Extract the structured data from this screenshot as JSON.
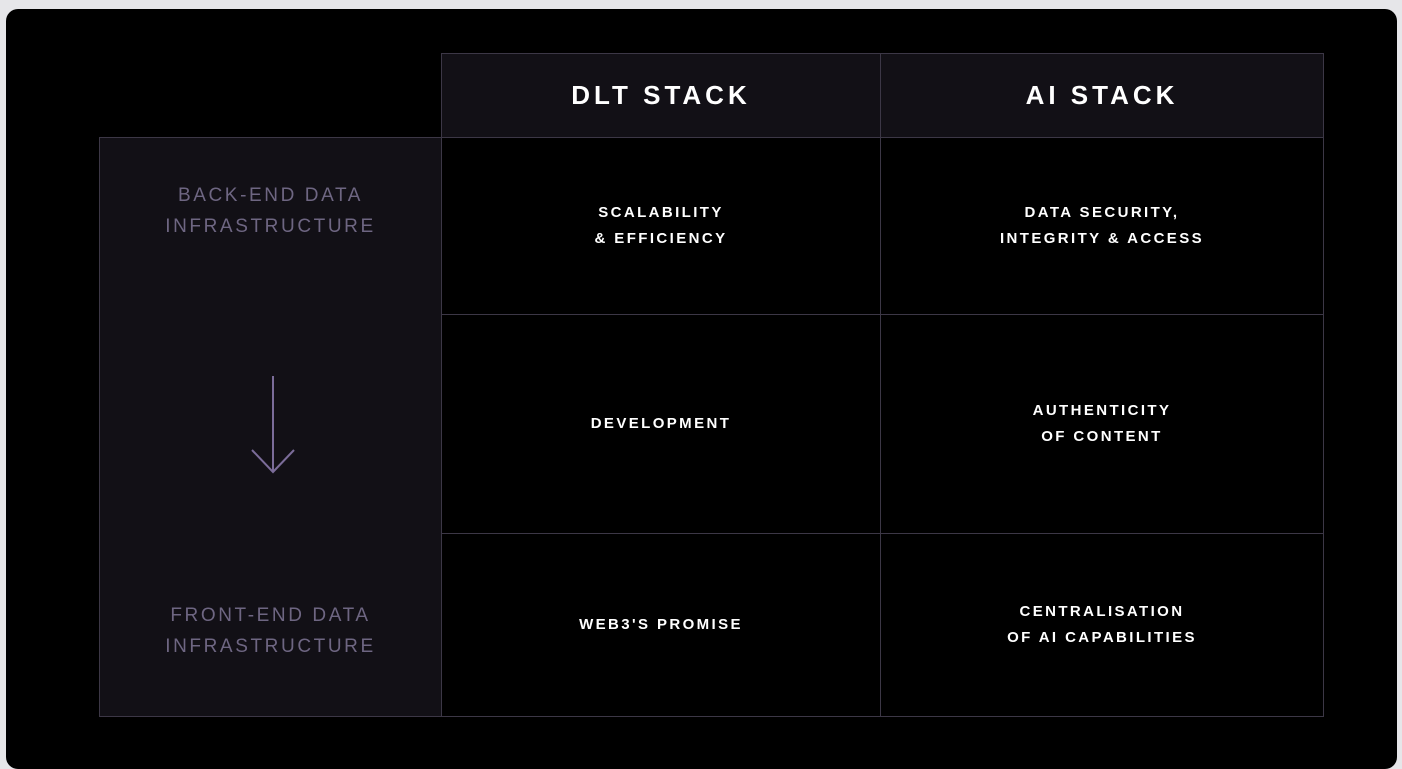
{
  "columns": {
    "dlt": "DLT STACK",
    "ai": "AI STACK"
  },
  "axis": {
    "top_label": "BACK-END DATA\nINFRASTRUCTURE",
    "bottom_label": "FRONT-END DATA\nINFRASTRUCTURE",
    "arrow_icon": "arrow-down-icon",
    "arrow_color": "#7b6c99"
  },
  "rows": [
    {
      "dlt": "SCALABILITY\n& EFFICIENCY",
      "ai": "DATA SECURITY,\nINTEGRITY & ACCESS"
    },
    {
      "dlt": "DEVELOPMENT",
      "ai": "AUTHENTICITY\nOF CONTENT"
    },
    {
      "dlt": "WEB3'S PROMISE",
      "ai": "CENTRALISATION\nOF AI CAPABILITIES"
    }
  ],
  "colors": {
    "background": "#000000",
    "header_fill": "#121016",
    "grid_line": "#3c3746",
    "muted_text": "#6e6682"
  }
}
